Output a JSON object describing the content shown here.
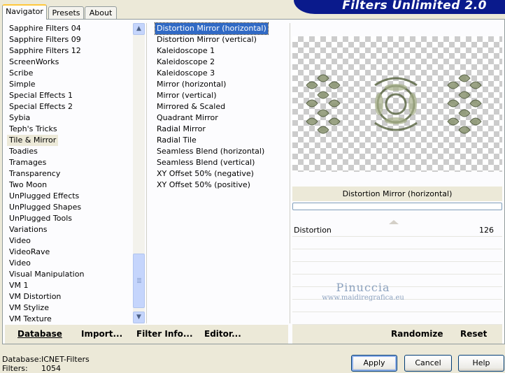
{
  "app": {
    "title": "Filters Unlimited 2.0"
  },
  "tabs": [
    {
      "label": "Navigator",
      "active": true
    },
    {
      "label": "Presets",
      "active": false
    },
    {
      "label": "About",
      "active": false
    }
  ],
  "categories": {
    "items": [
      "Sapphire Filters 04",
      "Sapphire Filters 09",
      "Sapphire Filters 12",
      "ScreenWorks",
      "Scribe",
      "Simple",
      "Special Effects 1",
      "Special Effects 2",
      "Sybia",
      "Teph's Tricks",
      "Tile & Mirror",
      "Toadies",
      "Tramages",
      "Transparency",
      "Two Moon",
      "UnPlugged Effects",
      "UnPlugged Shapes",
      "UnPlugged Tools",
      "Variations",
      "Video",
      "VideoRave",
      "Video",
      "Visual Manipulation",
      "VM 1",
      "VM Distortion",
      "VM Stylize",
      "VM Texture"
    ],
    "selected_index": 10
  },
  "filters": {
    "items": [
      "Distortion Mirror (horizontal)",
      "Distortion Mirror (vertical)",
      "Kaleidoscope 1",
      "Kaleidoscope 2",
      "Kaleidoscope 3",
      "Mirror (horizontal)",
      "Mirror (vertical)",
      "Mirrored & Scaled",
      "Quadrant Mirror",
      "Radial Mirror",
      "Radial Tile",
      "Seamless Blend (horizontal)",
      "Seamless Blend (vertical)",
      "XY Offset 50% (negative)",
      "XY Offset 50% (positive)"
    ],
    "selected_index": 0
  },
  "preview": {
    "filter_name": "Distortion Mirror (horizontal)",
    "progress": 0
  },
  "parameters": [
    {
      "label": "Distortion",
      "value": "126"
    }
  ],
  "watermark": {
    "line1": "Pinuccia",
    "line2": "www.maidiregrafica.eu"
  },
  "left_toolbar": {
    "database": "Database",
    "import": "Import...",
    "filter_info": "Filter Info...",
    "editor": "Editor..."
  },
  "right_toolbar": {
    "randomize": "Randomize",
    "reset": "Reset"
  },
  "status": {
    "database_key": "Database:",
    "database_value": "ICNET-Filters",
    "filters_key": "Filters:",
    "filters_value": "1054"
  },
  "buttons": {
    "apply": "Apply",
    "cancel": "Cancel",
    "help": "Help"
  },
  "colors": {
    "banner": "#0a1a8c",
    "selection": "#316ac5",
    "background": "#ece9d8"
  }
}
